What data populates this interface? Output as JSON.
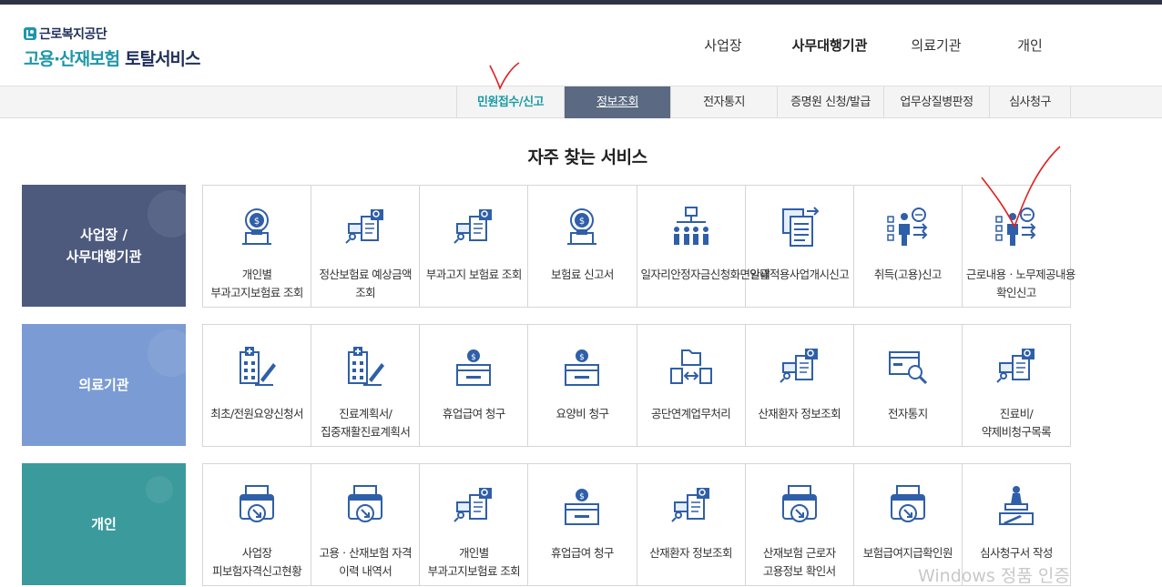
{
  "header": {
    "logo_top": "근로복지공단",
    "logo_main_a": "고용·산재보험",
    "logo_main_b": "토탈서비스",
    "nav": [
      "사업장",
      "사무대행기관",
      "의료기관",
      "개인"
    ],
    "active_nav": "사무대행기관"
  },
  "subnav": {
    "tabs": [
      "민원접수/신고",
      "정보조회",
      "전자통지",
      "증명원 신청/발급",
      "업무상질병판정",
      "심사청구"
    ],
    "selected": "정보조회"
  },
  "section_title": "자주 찾는 서비스",
  "categories": [
    {
      "title_line1": "사업장 /",
      "title_line2": "사무대행기관",
      "color": "#4d5a7e",
      "items": [
        {
          "label": "개인별 부과고지보험료 조회",
          "icon": "coin-bulb-icon"
        },
        {
          "label": "정산보험료 예상금액 조회",
          "icon": "document-search-icon"
        },
        {
          "label": "부과고지 보험료 조회",
          "icon": "document-search-icon"
        },
        {
          "label": "보험료 신고서",
          "icon": "coin-bulb-icon"
        },
        {
          "label": "일자리안정자금신청화면안내",
          "icon": "org-chart-icon"
        },
        {
          "label": "일괄적용사업개시신고",
          "icon": "document-stack-icon"
        },
        {
          "label": "취득(고용)신고",
          "icon": "person-chat-icon"
        },
        {
          "label": "근로내용ㆍ노무제공내용 확인신고",
          "icon": "person-chat-icon"
        }
      ]
    },
    {
      "title_line1": "의료기관",
      "title_line2": "",
      "color": "#7b9bd4",
      "items": [
        {
          "label": "최초/전원요양신청서",
          "icon": "hospital-pen-icon"
        },
        {
          "label": "진료계획서/집중재활진료계획서",
          "icon": "hospital-pen-icon"
        },
        {
          "label": "휴업급여 청구",
          "icon": "coin-box-icon"
        },
        {
          "label": "요양비 청구",
          "icon": "coin-box-icon"
        },
        {
          "label": "공단연계업무처리",
          "icon": "folder-exchange-icon"
        },
        {
          "label": "산재환자 정보조회",
          "icon": "document-search-icon"
        },
        {
          "label": "전자통지",
          "icon": "monitor-search-icon"
        },
        {
          "label": "진료비/약제비청구목록",
          "icon": "document-search-icon"
        }
      ]
    },
    {
      "title_line1": "개인",
      "title_line2": "",
      "color": "#3a9a9c",
      "items": [
        {
          "label": "사업장 피보험자격신고현황",
          "icon": "printer-arrow-icon"
        },
        {
          "label": "고용ㆍ산재보험 자격 이력 내역서",
          "icon": "printer-arrow-icon"
        },
        {
          "label": "개인별 부과고지보험료 조회",
          "icon": "document-search-icon"
        },
        {
          "label": "휴업급여 청구",
          "icon": "coin-box-icon"
        },
        {
          "label": "산재환자 정보조회",
          "icon": "document-search-icon"
        },
        {
          "label": "산재보험 근로자 고용정보 확인서",
          "icon": "printer-arrow-icon"
        },
        {
          "label": "보험급여지급확인원",
          "icon": "printer-arrow-icon"
        },
        {
          "label": "심사청구서 작성",
          "icon": "stamp-pen-icon"
        }
      ]
    }
  ],
  "watermark": "Windows 정품 인증",
  "colors": {
    "navy": "#1f2f5c",
    "teal": "#1a9aa6",
    "selected_tab": "#5b6a82",
    "icon_blue": "#2f5fa8",
    "annotation_red": "#e02020"
  }
}
